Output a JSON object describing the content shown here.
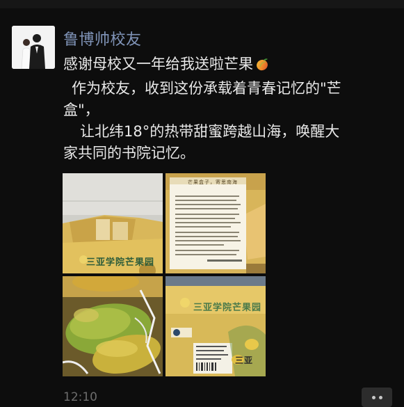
{
  "post": {
    "author": "鲁博帅校友",
    "lines": [
      "感谢母校又一年给我送啦芒果",
      "作为校友，收到这份承载着青春记忆的\"芒",
      "盒\"，",
      "让北纬18°的热带甜蜜跨越山海，唤醒大",
      "家共同的书院记忆。"
    ],
    "emoji_icon": "mango-emoji-icon",
    "time": "12:10"
  },
  "photos": {
    "photo1_box_text": "三亚学院芒果园",
    "photo2_letter_title": "芒果盒子，寄思南海",
    "photo3_box_text": "三亚学院芒果园",
    "photo4_label_text": "三亚"
  },
  "colors": {
    "author_name": "#8094b8",
    "body_text": "#e8e8e8",
    "background": "#0d0d0d"
  }
}
